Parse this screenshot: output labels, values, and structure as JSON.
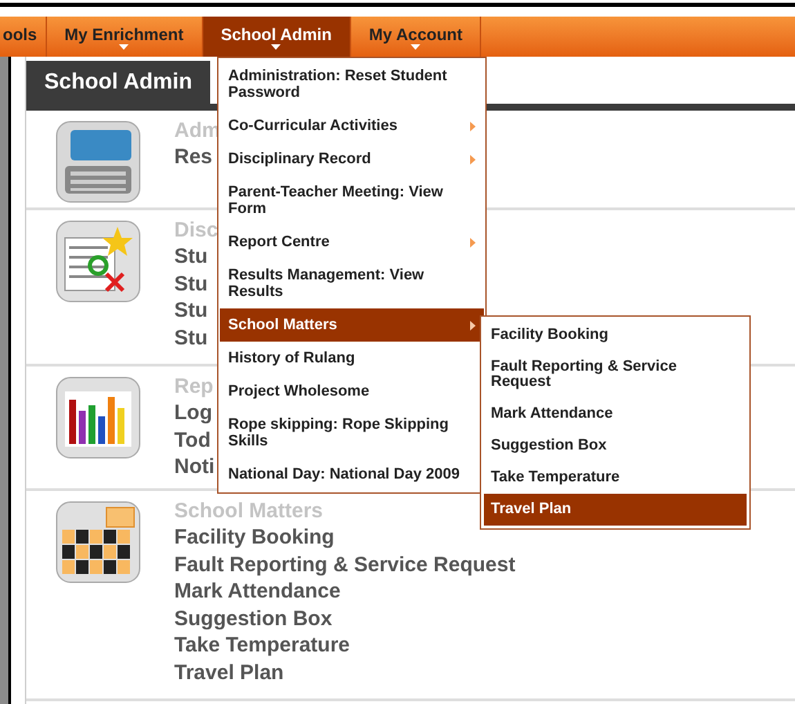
{
  "nav": {
    "items": [
      {
        "label": "ools",
        "selected": false
      },
      {
        "label": "My Enrichment",
        "selected": false
      },
      {
        "label": "School Admin",
        "selected": true
      },
      {
        "label": "My Account",
        "selected": false
      }
    ]
  },
  "page": {
    "tab": "School Admin"
  },
  "sections": [
    {
      "kind": "computer",
      "title": "Adm",
      "links": [
        "Res"
      ]
    },
    {
      "kind": "document",
      "title": "Disc",
      "links": [
        "Stu",
        "Stu",
        "Stu",
        "Stu"
      ]
    },
    {
      "kind": "chart",
      "title": "Rep",
      "links": [
        "Log",
        "Tod",
        "Noti"
      ]
    },
    {
      "kind": "calendar",
      "title": "School Matters",
      "links": [
        "Facility Booking",
        "Fault Reporting & Service Request",
        "Mark Attendance",
        "Suggestion Box",
        "Take Temperature",
        "Travel Plan"
      ]
    }
  ],
  "menu": {
    "items": [
      {
        "label": "Administration: Reset Student Password",
        "has_submenu": false,
        "selected": false
      },
      {
        "label": "Co-Curricular Activities",
        "has_submenu": true,
        "selected": false
      },
      {
        "label": "Disciplinary Record",
        "has_submenu": true,
        "selected": false
      },
      {
        "label": "Parent-Teacher Meeting: View Form",
        "has_submenu": false,
        "selected": false
      },
      {
        "label": "Report Centre",
        "has_submenu": true,
        "selected": false
      },
      {
        "label": "Results Management: View Results",
        "has_submenu": false,
        "selected": false
      },
      {
        "label": "School Matters",
        "has_submenu": true,
        "selected": true
      },
      {
        "label": "History of Rulang",
        "has_submenu": false,
        "selected": false
      },
      {
        "label": "Project Wholesome",
        "has_submenu": false,
        "selected": false
      },
      {
        "label": "Rope skipping: Rope Skipping Skills",
        "has_submenu": false,
        "selected": false
      },
      {
        "label": "National Day: National Day 2009",
        "has_submenu": false,
        "selected": false
      }
    ]
  },
  "submenu": {
    "items": [
      {
        "label": "Facility Booking",
        "selected": false
      },
      {
        "label": "Fault Reporting & Service Request",
        "selected": false
      },
      {
        "label": "Mark Attendance",
        "selected": false
      },
      {
        "label": "Suggestion Box",
        "selected": false
      },
      {
        "label": "Take Temperature",
        "selected": false
      },
      {
        "label": "Travel Plan",
        "selected": true
      }
    ]
  }
}
